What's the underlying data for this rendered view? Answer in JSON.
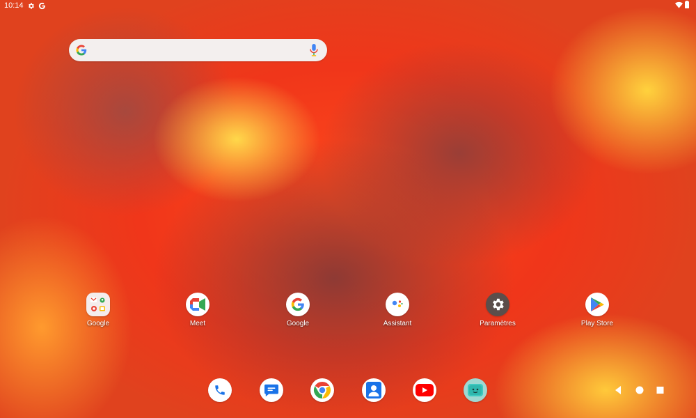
{
  "status_bar": {
    "time": "10:14",
    "left_icons": [
      "gear-icon",
      "google-g-icon"
    ],
    "right_icons": [
      "wifi-icon",
      "battery-icon"
    ]
  },
  "search": {
    "placeholder": "",
    "left_icon": "google-g-icon",
    "right_icon": "mic-icon"
  },
  "apps": [
    {
      "label": "Google",
      "icon": "google-folder-icon"
    },
    {
      "label": "Meet",
      "icon": "meet-icon"
    },
    {
      "label": "Google",
      "icon": "google-g-icon"
    },
    {
      "label": "Assistant",
      "icon": "assistant-icon"
    },
    {
      "label": "Paramètres",
      "icon": "settings-icon"
    },
    {
      "label": "Play Store",
      "icon": "play-store-icon"
    }
  ],
  "dock": [
    {
      "icon": "phone-icon"
    },
    {
      "icon": "messages-icon"
    },
    {
      "icon": "chrome-icon"
    },
    {
      "icon": "contacts-icon"
    },
    {
      "icon": "youtube-icon"
    },
    {
      "icon": "app-icon"
    }
  ],
  "nav": [
    "back-icon",
    "home-icon",
    "recents-icon"
  ],
  "colors": {
    "google_blue": "#4285F4",
    "google_red": "#EA4335",
    "google_yellow": "#FBBC05",
    "google_green": "#34A853"
  }
}
